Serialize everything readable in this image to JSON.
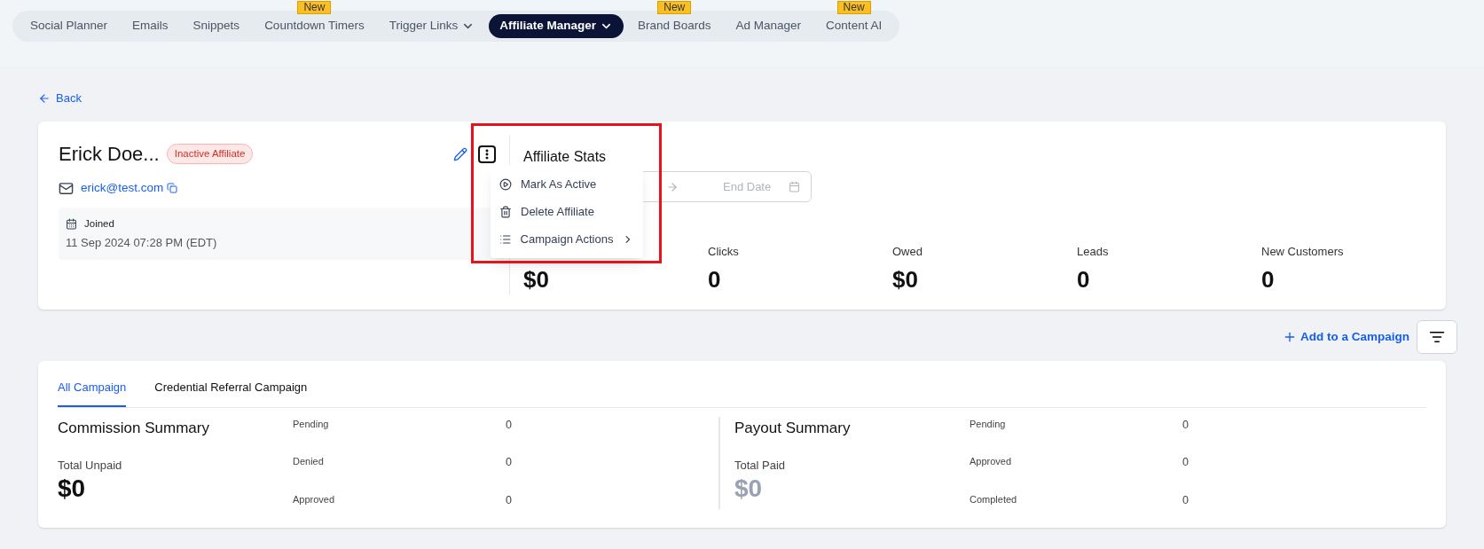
{
  "nav": {
    "items": [
      {
        "label": "Social Planner",
        "selected": false,
        "dropdown": false
      },
      {
        "label": "Emails",
        "selected": false,
        "dropdown": false
      },
      {
        "label": "Snippets",
        "selected": false,
        "dropdown": false
      },
      {
        "label": "Countdown Timers",
        "selected": false,
        "badge": "New",
        "dropdown": false
      },
      {
        "label": "Trigger Links",
        "selected": false,
        "dropdown": true
      },
      {
        "label": "Affiliate Manager",
        "selected": true,
        "dropdown": true
      },
      {
        "label": "Brand Boards",
        "selected": false,
        "badge": "New",
        "dropdown": false
      },
      {
        "label": "Ad Manager",
        "selected": false,
        "dropdown": false
      },
      {
        "label": "Content AI",
        "selected": false,
        "badge": "New",
        "dropdown": false
      }
    ]
  },
  "back": "Back",
  "profile": {
    "name": "Erick Doe...",
    "status": "Inactive Affiliate",
    "email": "erick@test.com",
    "joined_label": "Joined",
    "joined_value": "11 Sep 2024 07:28 PM (EDT)"
  },
  "menu": {
    "items": [
      {
        "kind": "play",
        "label": "Mark As Active",
        "submenu": false
      },
      {
        "kind": "trash",
        "label": "Delete Affiliate",
        "submenu": false
      },
      {
        "kind": "list",
        "label": "Campaign Actions",
        "submenu": true
      }
    ]
  },
  "stats": {
    "title": "Affiliate Stats",
    "end_date_placeholder": "End Date",
    "items": [
      {
        "value": "$0"
      },
      {
        "label": "Clicks",
        "value": "0"
      },
      {
        "label": "Owed",
        "value": "$0"
      },
      {
        "label": "Leads",
        "value": "0"
      },
      {
        "label": "New Customers",
        "value": "0"
      }
    ]
  },
  "add_campaign": "Add to a Campaign",
  "tabs": [
    {
      "label": "All Campaign",
      "selected": true
    },
    {
      "label": "Credential Referral Campaign",
      "selected": false
    }
  ],
  "summaries": [
    {
      "title": "Commission Summary",
      "total_label": "Total Unpaid",
      "total": "$0",
      "muted": false,
      "rows": [
        {
          "label": "Pending",
          "value": "0"
        },
        {
          "label": "Denied",
          "value": "0"
        },
        {
          "label": "Approved",
          "value": "0"
        }
      ]
    },
    {
      "title": "Payout Summary",
      "total_label": "Total Paid",
      "total": "$0",
      "muted": true,
      "rows": [
        {
          "label": "Pending",
          "value": "0"
        },
        {
          "label": "Approved",
          "value": "0"
        },
        {
          "label": "Completed",
          "value": "0"
        }
      ]
    }
  ]
}
